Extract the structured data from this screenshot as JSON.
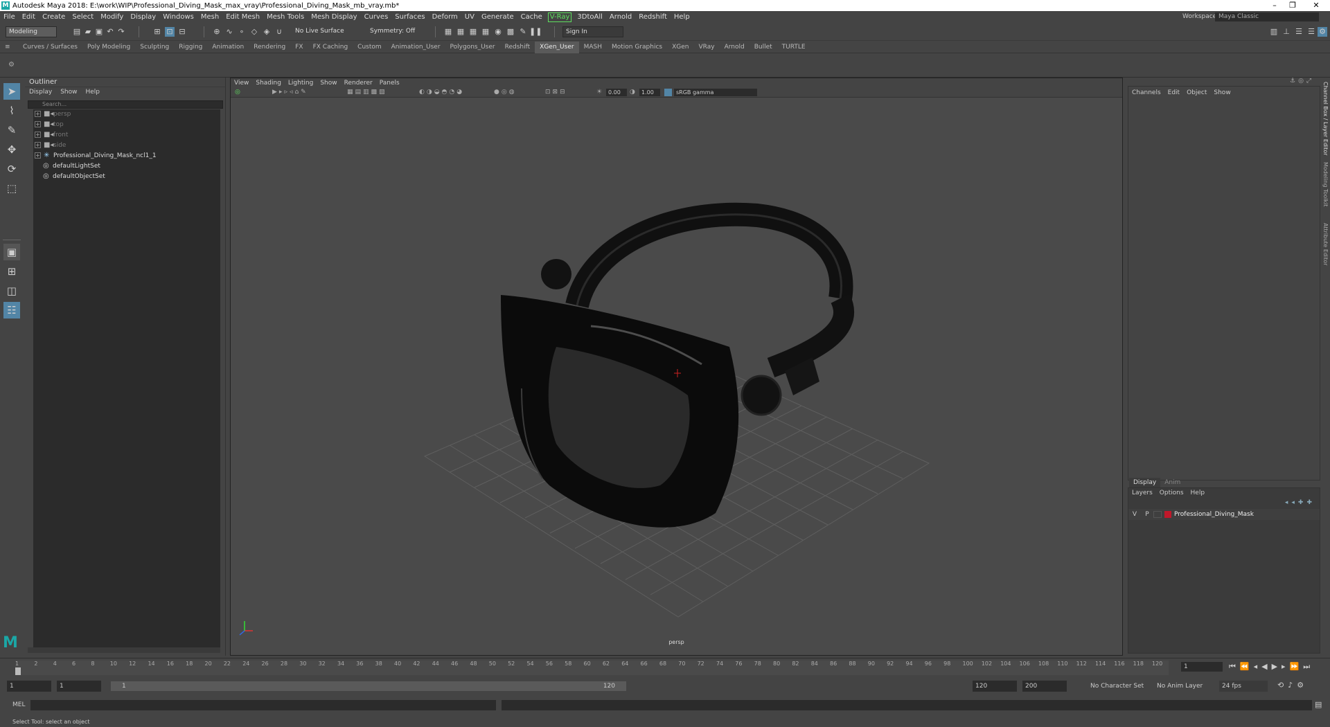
{
  "titlebar": {
    "text": "Autodesk Maya 2018: E:\\work\\WIP\\Professional_Diving_Mask_max_vray\\Professional_Diving_Mask_mb_vray.mb*"
  },
  "menus": [
    "File",
    "Edit",
    "Create",
    "Select",
    "Modify",
    "Display",
    "Windows",
    "Mesh",
    "Edit Mesh",
    "Mesh Tools",
    "Mesh Display",
    "Curves",
    "Surfaces",
    "Deform",
    "UV",
    "Generate",
    "Cache",
    "V-Ray",
    "3DtoAll",
    "Arnold",
    "Redshift",
    "Help"
  ],
  "workspace": {
    "label": "Workspace :",
    "value": "Maya Classic"
  },
  "toolbar": {
    "mode": "Modeling",
    "live_surface": "No Live Surface",
    "symmetry": "Symmetry: Off",
    "sign_in": "Sign In"
  },
  "shelf_tabs": [
    "Curves / Surfaces",
    "Poly Modeling",
    "Sculpting",
    "Rigging",
    "Animation",
    "Rendering",
    "FX",
    "FX Caching",
    "Custom",
    "Animation_User",
    "Polygons_User",
    "Redshift",
    "XGen_User",
    "MASH",
    "Motion Graphics",
    "XGen",
    "VRay",
    "Arnold",
    "Bullet",
    "TURTLE"
  ],
  "active_shelf": "XGen_User",
  "outliner": {
    "title": "Outliner",
    "menu": [
      "Display",
      "Show",
      "Help"
    ],
    "search_placeholder": "Search...",
    "items": [
      {
        "label": "persp",
        "dim": true
      },
      {
        "label": "top",
        "dim": true
      },
      {
        "label": "front",
        "dim": true
      },
      {
        "label": "side",
        "dim": true
      },
      {
        "label": "Professional_Diving_Mask_ncl1_1",
        "dim": false
      },
      {
        "label": "defaultLightSet",
        "dim": false
      },
      {
        "label": "defaultObjectSet",
        "dim": false
      }
    ]
  },
  "viewport": {
    "menu": [
      "View",
      "Shading",
      "Lighting",
      "Show",
      "Renderer",
      "Panels"
    ],
    "exposure": "0.00",
    "gamma": "1.00",
    "color_space": "sRGB gamma",
    "camera_label": "persp"
  },
  "channel_box": {
    "menu": [
      "Channels",
      "Edit",
      "Object",
      "Show"
    ],
    "side_tabs": [
      "Channel Box / Layer Editor",
      "Modeling Toolkit",
      "Attribute Editor"
    ]
  },
  "layer_editor": {
    "tabs": [
      "Display",
      "Anim"
    ],
    "menu": [
      "Layers",
      "Options",
      "Help"
    ],
    "layer": {
      "v": "V",
      "p": "P",
      "name": "Professional_Diving_Mask",
      "color": "#c0182a"
    }
  },
  "timeline": {
    "ticks": [
      "1",
      "2",
      "4",
      "6",
      "8",
      "10",
      "12",
      "14",
      "16",
      "18",
      "20",
      "22",
      "24",
      "26",
      "28",
      "30",
      "32",
      "34",
      "36",
      "38",
      "40",
      "42",
      "44",
      "46",
      "48",
      "50",
      "52",
      "54",
      "56",
      "58",
      "60",
      "62",
      "64",
      "66",
      "68",
      "70",
      "72",
      "74",
      "76",
      "78",
      "80",
      "82",
      "84",
      "86",
      "88",
      "90",
      "92",
      "94",
      "96",
      "98",
      "100",
      "102",
      "104",
      "106",
      "108",
      "110",
      "112",
      "114",
      "116",
      "118",
      "120"
    ],
    "current_frame": "1"
  },
  "range": {
    "start": "1",
    "start2": "1",
    "slider_start": "1",
    "slider_end": "120",
    "end": "120",
    "end2": "200",
    "character_set": "No Character Set",
    "anim_layer": "No Anim Layer",
    "fps": "24 fps"
  },
  "command": {
    "label": "MEL"
  },
  "status": {
    "text": "Select Tool: select an object"
  }
}
